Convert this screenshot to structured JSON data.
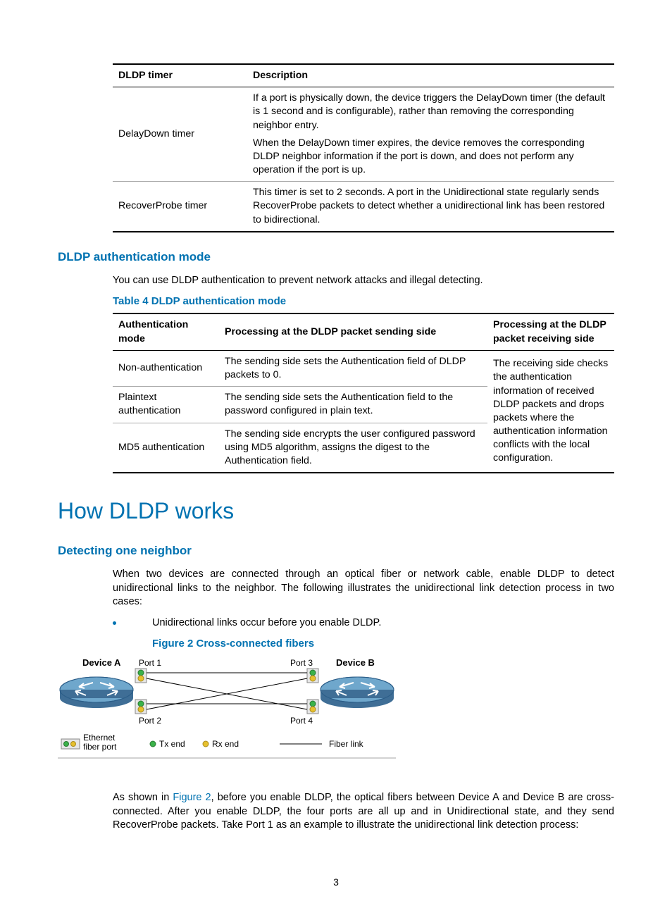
{
  "table1": {
    "headers": [
      "DLDP timer",
      "Description"
    ],
    "rows": [
      {
        "c0": "DelayDown timer",
        "c1a": "If a port is physically down, the device triggers the DelayDown timer (the default is 1 second and is configurable), rather than removing the corresponding neighbor entry.",
        "c1b": "When the DelayDown timer expires, the device removes the corresponding DLDP neighbor information if the port is down, and does not perform any operation if the port is up."
      },
      {
        "c0": "RecoverProbe timer",
        "c1": "This timer is set to 2 seconds. A port in the Unidirectional state regularly sends RecoverProbe packets to detect whether a unidirectional link has been restored to bidirectional."
      }
    ]
  },
  "sec_auth": {
    "title": "DLDP authentication mode",
    "intro": "You can use DLDP authentication to prevent network attacks and illegal detecting.",
    "caption": "Table 4 DLDP authentication mode"
  },
  "table2": {
    "headers": [
      "Authentication mode",
      "Processing at the DLDP packet sending side",
      "Processing at the DLDP packet receiving side"
    ],
    "rows": [
      {
        "c0": "Non-authentication",
        "c1": "The sending side sets the Authentication field of DLDP packets to 0."
      },
      {
        "c0": "Plaintext authentication",
        "c1": "The sending side sets the Authentication field to the password configured in plain text."
      },
      {
        "c0": "MD5 authentication",
        "c1": "The sending side encrypts the user configured password using MD5 algorithm, assigns the digest to the Authentication field."
      }
    ],
    "col3": "The receiving side checks the authentication information of received DLDP packets and drops packets where the authentication information conflicts with the local configuration."
  },
  "sec_how": {
    "title": "How DLDP works",
    "sub": "Detecting one neighbor",
    "p1": "When two devices are connected through an optical fiber or network cable, enable DLDP to detect unidirectional links to the neighbor. The following illustrates the unidirectional link detection process in two cases:",
    "bullet1": "Unidirectional links occur before you enable DLDP.",
    "figcap": "Figure 2 Cross-connected fibers",
    "p2a": "As shown in ",
    "p2link": "Figure 2",
    "p2b": ", before you enable DLDP, the optical fibers between Device A and Device B are cross-connected. After you enable DLDP, the four ports are all up and in Unidirectional state, and they send RecoverProbe packets. Take Port 1 as an example to illustrate the unidirectional link detection process:"
  },
  "figure": {
    "devA": "Device A",
    "devB": "Device B",
    "p1": "Port 1",
    "p2": "Port 2",
    "p3": "Port 3",
    "p4": "Port 4",
    "legend_eth": "Ethernet\nfiber port",
    "tx": "Tx end",
    "rx": "Rx end",
    "fl": "Fiber link"
  },
  "pagenum": "3"
}
